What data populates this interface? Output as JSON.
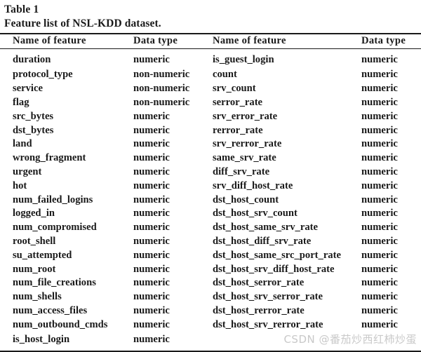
{
  "caption": {
    "label": "Table 1",
    "text": "Feature list of NSL-KDD dataset."
  },
  "headers": {
    "name_left": "Name of feature",
    "type_left": "Data type",
    "name_right": "Name of feature",
    "type_right": "Data type"
  },
  "rows": [
    {
      "name_left": "duration",
      "type_left": "numeric",
      "name_right": "is_guest_login",
      "type_right": "numeric"
    },
    {
      "name_left": "protocol_type",
      "type_left": "non-numeric",
      "name_right": "count",
      "type_right": "numeric"
    },
    {
      "name_left": "service",
      "type_left": "non-numeric",
      "name_right": "srv_count",
      "type_right": "numeric"
    },
    {
      "name_left": "flag",
      "type_left": "non-numeric",
      "name_right": "serror_rate",
      "type_right": "numeric"
    },
    {
      "name_left": "src_bytes",
      "type_left": "numeric",
      "name_right": "srv_error_rate",
      "type_right": "numeric"
    },
    {
      "name_left": "dst_bytes",
      "type_left": "numeric",
      "name_right": "rerror_rate",
      "type_right": "numeric"
    },
    {
      "name_left": "land",
      "type_left": "numeric",
      "name_right": "srv_rerror_rate",
      "type_right": "numeric"
    },
    {
      "name_left": "wrong_fragment",
      "type_left": "numeric",
      "name_right": "same_srv_rate",
      "type_right": "numeric"
    },
    {
      "name_left": "urgent",
      "type_left": "numeric",
      "name_right": "diff_srv_rate",
      "type_right": "numeric"
    },
    {
      "name_left": "hot",
      "type_left": "numeric",
      "name_right": "srv_diff_host_rate",
      "type_right": "numeric"
    },
    {
      "name_left": "num_failed_logins",
      "type_left": "numeric",
      "name_right": "dst_host_count",
      "type_right": "numeric"
    },
    {
      "name_left": "logged_in",
      "type_left": "numeric",
      "name_right": "dst_host_srv_count",
      "type_right": "numeric"
    },
    {
      "name_left": "num_compromised",
      "type_left": "numeric",
      "name_right": "dst_host_same_srv_rate",
      "type_right": "numeric"
    },
    {
      "name_left": "root_shell",
      "type_left": "numeric",
      "name_right": "dst_host_diff_srv_rate",
      "type_right": "numeric"
    },
    {
      "name_left": "su_attempted",
      "type_left": "numeric",
      "name_right": "dst_host_same_src_port_rate",
      "type_right": "numeric"
    },
    {
      "name_left": "num_root",
      "type_left": "numeric",
      "name_right": "dst_host_srv_diff_host_rate",
      "type_right": "numeric"
    },
    {
      "name_left": "num_file_creations",
      "type_left": "numeric",
      "name_right": "dst_host_serror_rate",
      "type_right": "numeric"
    },
    {
      "name_left": "num_shells",
      "type_left": "numeric",
      "name_right": "dst_host_srv_serror_rate",
      "type_right": "numeric"
    },
    {
      "name_left": "num_access_files",
      "type_left": "numeric",
      "name_right": "dst_host_rerror_rate",
      "type_right": "numeric"
    },
    {
      "name_left": "num_outbound_cmds",
      "type_left": "numeric",
      "name_right": "dst_host_srv_rerror_rate",
      "type_right": "numeric"
    },
    {
      "name_left": "is_host_login",
      "type_left": "numeric",
      "name_right": "",
      "type_right": ""
    }
  ],
  "watermark": "CSDN @番茄炒西红柿炒蛋"
}
